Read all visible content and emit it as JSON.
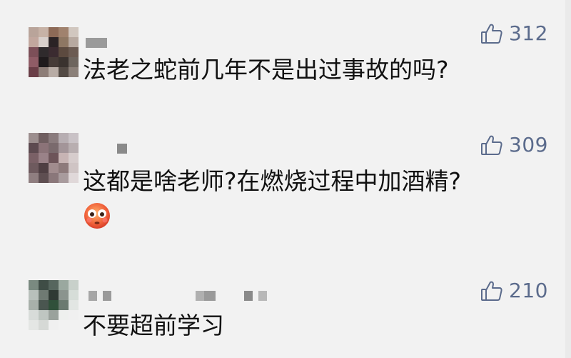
{
  "comments": [
    {
      "text": "法老之蛇前几年不是出过事故的吗?",
      "likes": "312"
    },
    {
      "text": "这都是啥老师?在燃烧过程中加酒精?",
      "likes": "309",
      "emoji": "flushed-face-emoji"
    },
    {
      "text": "不要超前学习",
      "likes": "210"
    }
  ],
  "colors": {
    "background": "#f2f2f2",
    "like_color": "#5b6b8c",
    "text_color": "#111111"
  },
  "icons": {
    "like": "thumbs-up-icon"
  }
}
